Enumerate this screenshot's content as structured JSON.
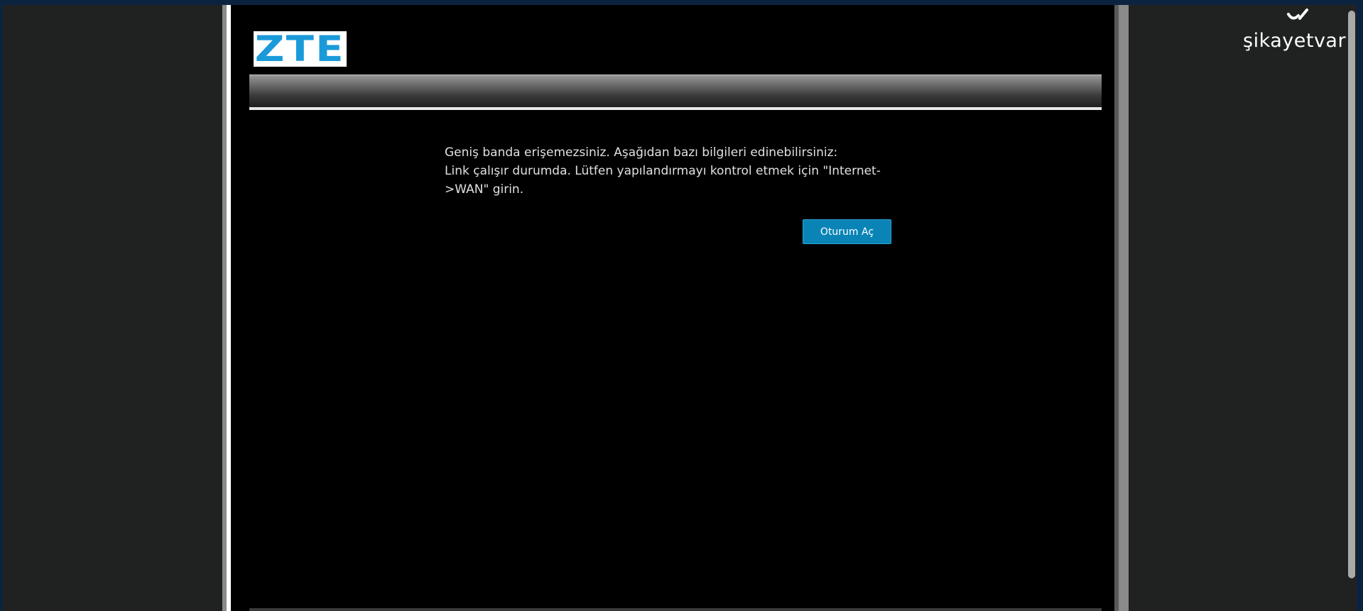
{
  "logo": {
    "text": "ZTE",
    "color": "#1a9ad9"
  },
  "message": {
    "line1": "Geniş banda erişemezsiniz. Aşağıdan bazı bilgileri edinebilirsiniz:",
    "line2": "Link çalışır durumda. Lütfen yapılandırmayı kontrol etmek için \"Internet-",
    "line3": ">WAN\" girin."
  },
  "login_button": {
    "label": "Oturum Aç",
    "color": "#0a84b6"
  },
  "watermark": {
    "text": "şikayetvar",
    "icon": "sikayetvar-logo-icon"
  }
}
